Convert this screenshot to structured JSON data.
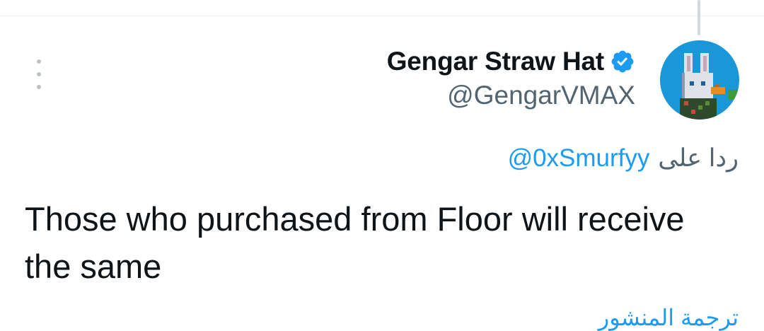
{
  "author": {
    "display_name": "Gengar Straw Hat",
    "handle": "@GengarVMAX",
    "verified": true,
    "avatar_bg": "#1a97d8"
  },
  "reply": {
    "prefix": "ردا على",
    "mention": "@0xSmurfyy"
  },
  "tweet": {
    "text": "Those who purchased from Floor will receive the same"
  },
  "translate": {
    "label": "ترجمة المنشور"
  },
  "colors": {
    "accent": "#1d9bf0",
    "secondary_text": "#536471",
    "primary_text": "#0f1419"
  },
  "icons": {
    "more": "more-vertical-icon",
    "verified": "verified-badge-icon"
  }
}
